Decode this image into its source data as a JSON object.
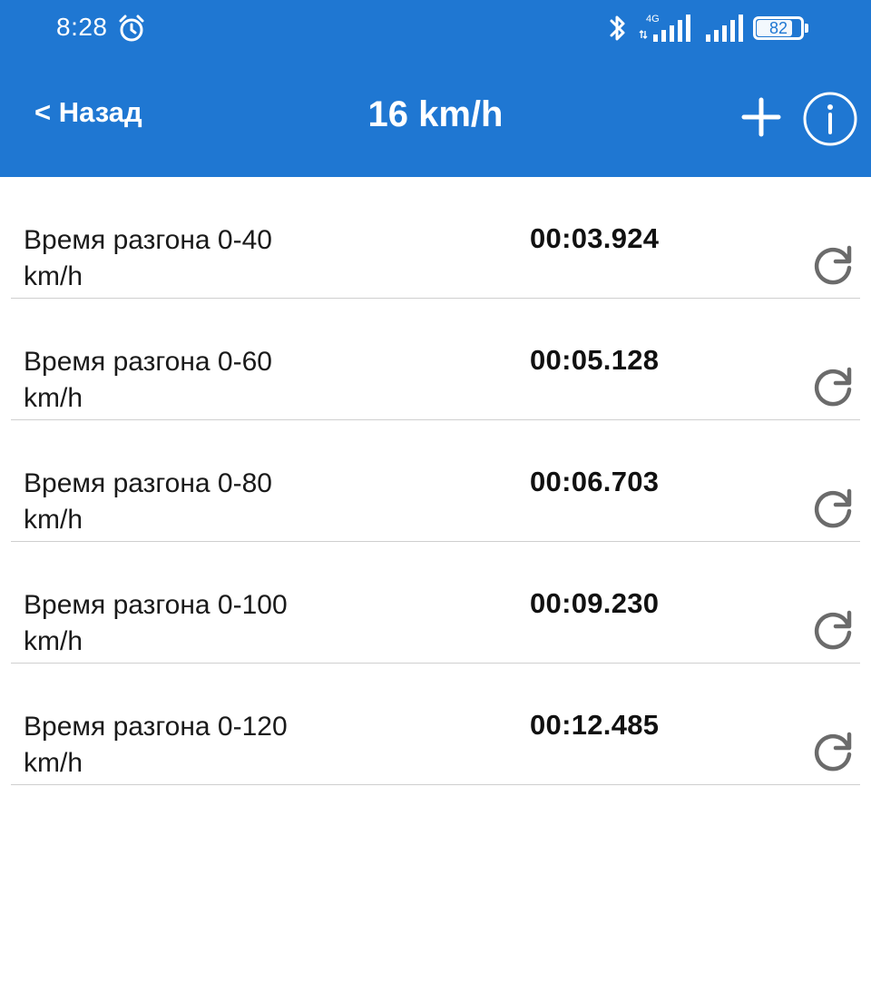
{
  "status_bar": {
    "time": "8:28",
    "network_label": "4G",
    "battery": "82",
    "battery_level": 0.82
  },
  "header": {
    "back_label": "< Назад",
    "title": "16 km/h",
    "add_icon": "plus-icon",
    "info_icon": "info-icon"
  },
  "list": {
    "rows": [
      {
        "label": "Время разгона  0-40\nkm/h",
        "time": "00:03.924"
      },
      {
        "label": "Время разгона  0-60\nkm/h",
        "time": "00:05.128"
      },
      {
        "label": "Время разгона  0-80\nkm/h",
        "time": "00:06.703"
      },
      {
        "label": "Время разгона  0-100\nkm/h",
        "time": "00:09.230"
      },
      {
        "label": "Время разгона  0-120\nkm/h",
        "time": "00:12.485"
      }
    ],
    "row_action_icon": "refresh-icon"
  },
  "colors": {
    "header_bg": "#1f77d2",
    "icon_gray": "#6b6b6b",
    "divider": "#cfcfcf"
  }
}
